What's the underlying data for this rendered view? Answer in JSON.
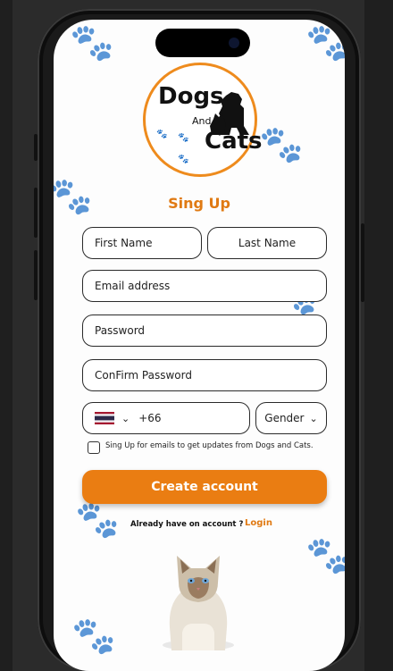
{
  "brand": {
    "logo_word_1": "Dogs",
    "logo_word_2": "And",
    "logo_word_3": "Cats"
  },
  "page": {
    "title": "Sing Up"
  },
  "form": {
    "first_name": "First Name",
    "last_name": "Last Name",
    "email": "Email address",
    "password": "Password",
    "confirm_password": "ConFirm Password",
    "country_code": "+66",
    "gender": "Gender",
    "gender_chevron": "⌄",
    "country_chevron": "⌄",
    "newsletter_label": "Sing Up for emails to get updates from  Dogs and Cats.",
    "create_button": "Create account"
  },
  "footer": {
    "already_text": "Already have on account ?",
    "login_link": "Login"
  },
  "colors": {
    "accent": "#ea7d12",
    "title": "#e07a13",
    "paw": "#f6dcc0"
  },
  "icons": [
    "paw-icon",
    "thailand-flag-icon",
    "chevron-down-icon",
    "cat-photo"
  ]
}
